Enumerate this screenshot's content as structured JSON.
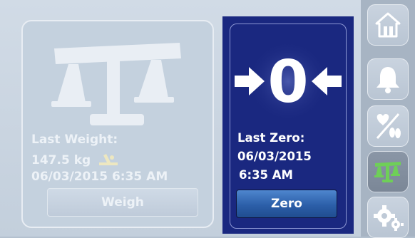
{
  "weigh_panel": {
    "last_weight_label": "Last Weight:",
    "weight_value": "147.5 kg",
    "datetime": "06/03/2015   6:35 AM",
    "weigh_button_label": "Weigh",
    "icons": [
      "scale-icon",
      "bed-incline-icon"
    ]
  },
  "zero_panel": {
    "zero_digit": "0",
    "last_zero_label": "Last Zero:",
    "date": "06/03/2015",
    "time": "6:35 AM",
    "zero_button_label": "Zero",
    "icons": [
      "arrow-right-icon",
      "arrow-left-icon"
    ]
  },
  "nav": {
    "items": [
      {
        "name": "home",
        "icon": "home-icon"
      },
      {
        "name": "alarm",
        "icon": "bell-icon"
      },
      {
        "name": "health",
        "icon": "heart-feet-icon"
      },
      {
        "name": "scale",
        "icon": "scale-icon",
        "active": true
      },
      {
        "name": "settings",
        "icon": "gears-icon"
      }
    ]
  },
  "colors": {
    "zero_panel_bg": "#1a2880",
    "zero_button": "#2c5fa9",
    "active_scale_icon": "#6fcf58",
    "nav_bg": "#a7b4c3"
  }
}
